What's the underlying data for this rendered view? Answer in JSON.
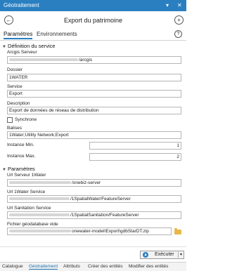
{
  "window": {
    "title": "Géotraitement",
    "pin_glyph": "▾",
    "close_glyph": "✕"
  },
  "header": {
    "title": "Export du patrimoine",
    "back_glyph": "←",
    "add_glyph": "+"
  },
  "tabs": {
    "items": [
      {
        "label": "Paramètres",
        "active": true
      },
      {
        "label": "Environnements",
        "active": false
      }
    ],
    "help_glyph": "?"
  },
  "section1": {
    "title": "Définition du service",
    "fields": {
      "arcgis_server": {
        "label": "Arcgis Serveur",
        "value_suffix": "/arcgis"
      },
      "dossier": {
        "label": "Dossier",
        "value": "1WATER"
      },
      "service": {
        "label": "Service",
        "value": "Export"
      },
      "description": {
        "label": "Description",
        "value": "Export de données de réseau de distribution"
      },
      "synchrone": {
        "label": "Synchrone",
        "checked": false
      },
      "balises": {
        "label": "Balises",
        "value": "1Water;Utility Network;Export"
      },
      "instance_min": {
        "label": "Instance Min.",
        "value": "1"
      },
      "instance_max": {
        "label": "Instance Max.",
        "value": "2"
      }
    }
  },
  "section2": {
    "title": "Paramètres",
    "fields": {
      "url_serveur": {
        "label": "Url Serveur 1Water",
        "value_suffix": "/onebiz-server"
      },
      "url_1water_service": {
        "label": "Url 1Water Service",
        "value_suffix": "/1SpatialWater/FeatureServer"
      },
      "url_sanitation": {
        "label": "Url Sanitation Service",
        "value_suffix": "/1SpatialSanitation/FeatureServer"
      },
      "fichier_gdb": {
        "label": "Fichier géodatabase vide",
        "value_suffix": "onewater-model\\Export\\gdbStarDT.zip"
      }
    }
  },
  "actions": {
    "run_label": "Exécuter",
    "caret_glyph": "▾"
  },
  "bottom_tabs": [
    {
      "label": "Catalogue",
      "active": false
    },
    {
      "label": "Géotraitement",
      "active": true
    },
    {
      "label": "Attributs",
      "active": false
    },
    {
      "label": "Créer des entités",
      "active": false
    },
    {
      "label": "Modifier des entités",
      "active": false
    }
  ],
  "colors": {
    "accent": "#2a7fc0",
    "folder": "#e8b84b"
  }
}
